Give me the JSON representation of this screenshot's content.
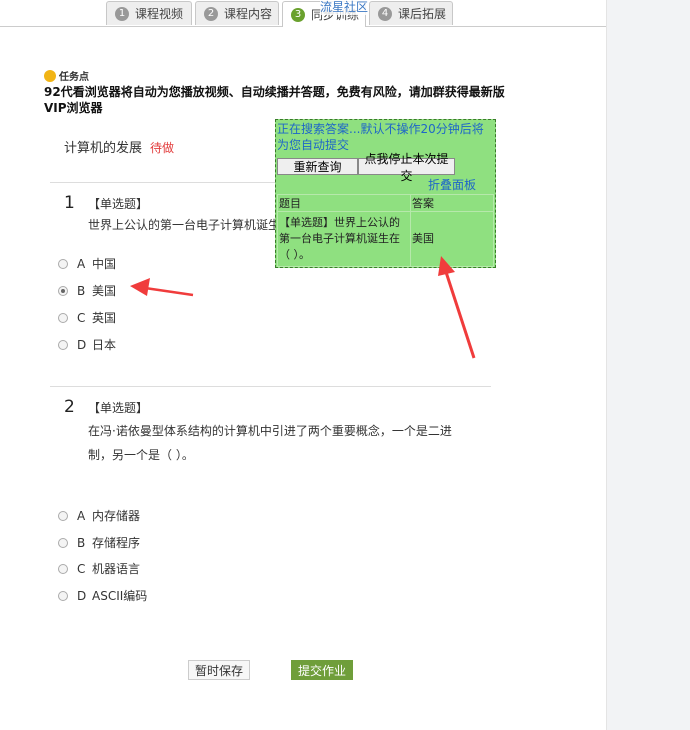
{
  "tabs": [
    {
      "num": "1",
      "label": "课程视频"
    },
    {
      "num": "2",
      "label": "课程内容"
    },
    {
      "num": "3",
      "label": "同步训练"
    },
    {
      "num": "4",
      "label": "课后拓展"
    }
  ],
  "watermark": "流星社区",
  "task": {
    "title": "任务点",
    "notice": "92代看浏览器将自动为您播放视频、自动续播并答题，免费有风险，请加群获得最新版VIP浏览器"
  },
  "chapter": {
    "name": "计算机的发展",
    "status": "待做"
  },
  "questions": [
    {
      "num": "1",
      "type": "【单选题】",
      "text": "世界上公认的第一台电子计算机诞生在",
      "options": [
        {
          "letter": "A",
          "text": "中国"
        },
        {
          "letter": "B",
          "text": "美国"
        },
        {
          "letter": "C",
          "text": "英国"
        },
        {
          "letter": "D",
          "text": "日本"
        }
      ]
    },
    {
      "num": "2",
      "type": "【单选题】",
      "text": "在冯·诺依曼型体系结构的计算机中引进了两个重要概念，一个是二进制，另一个是（    ）。",
      "options": [
        {
          "letter": "A",
          "text": "内存储器"
        },
        {
          "letter": "B",
          "text": "存储程序"
        },
        {
          "letter": "C",
          "text": "机器语言"
        },
        {
          "letter": "D",
          "text": "ASCII编码"
        }
      ]
    }
  ],
  "buttons": {
    "save": "暂时保存",
    "submit": "提交作业"
  },
  "panel": {
    "message": "正在搜索答案...默认不操作20分钟后将为您自动提交",
    "requery": "重新查询",
    "stop": "点我停止本次提交",
    "collapse": "折叠面板",
    "col_question": "题目",
    "col_answer": "答案",
    "row_question": "【单选题】世界上公认的第一台电子计算机诞生在（    ）。",
    "row_answer": "美国"
  },
  "colors": {
    "accent": "#6aa12e",
    "panel_bg": "#8fe080",
    "status": "#e23b3b",
    "arrow": "#f03c3c"
  }
}
